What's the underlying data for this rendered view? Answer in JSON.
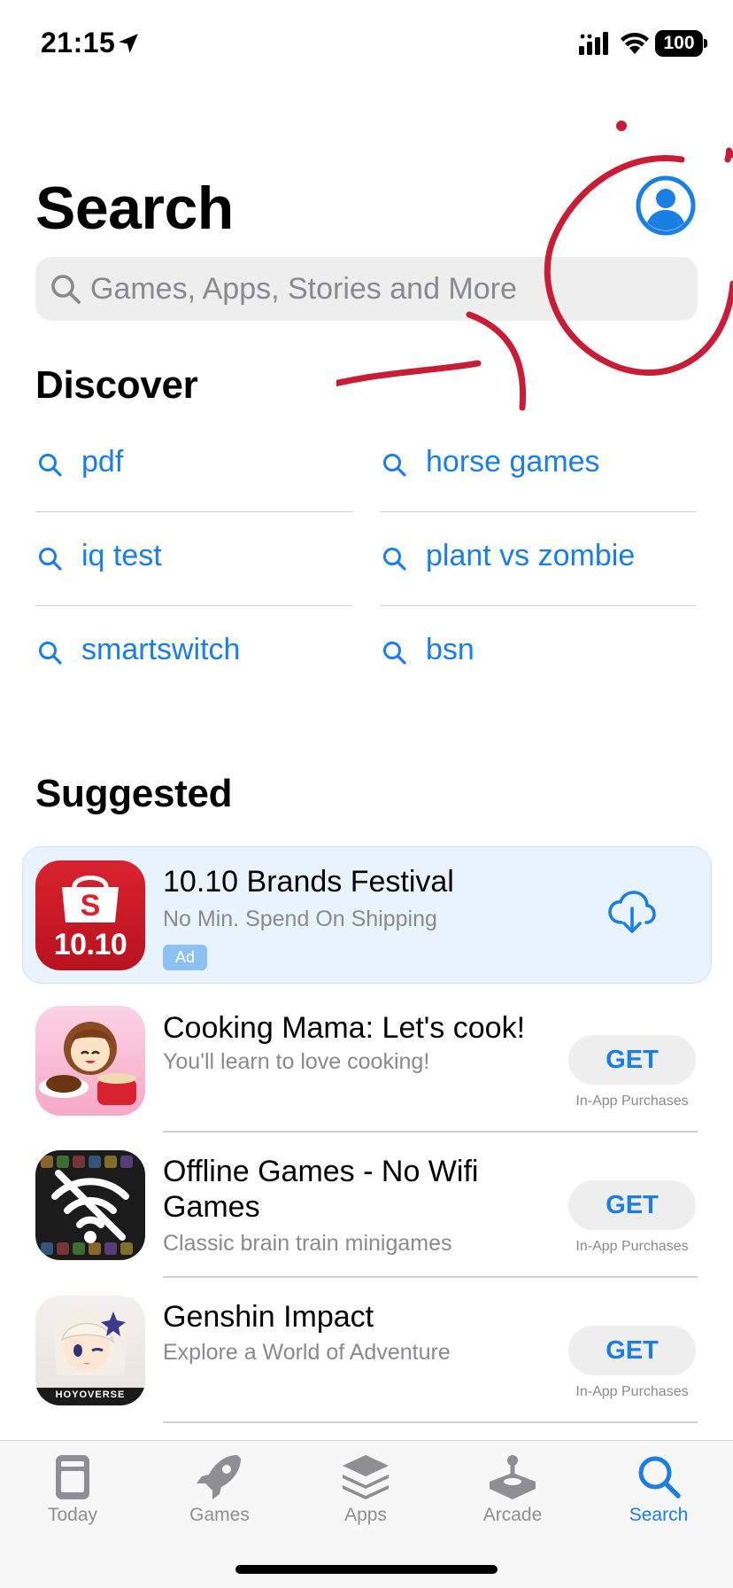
{
  "status_bar": {
    "time": "21:15",
    "battery": "100",
    "icons": [
      "location-arrow-icon",
      "cellular-signal-icon",
      "wifi-icon",
      "battery-icon"
    ]
  },
  "header": {
    "title": "Search",
    "account_icon": "person-circle-icon"
  },
  "search": {
    "placeholder": "Games, Apps, Stories and More",
    "value": "",
    "icon": "magnifying-glass-icon"
  },
  "discover": {
    "title": "Discover",
    "items": [
      {
        "label": "pdf"
      },
      {
        "label": "horse games"
      },
      {
        "label": "iq test"
      },
      {
        "label": "plant vs zombie"
      },
      {
        "label": "smartswitch"
      },
      {
        "label": "bsn"
      }
    ]
  },
  "suggested": {
    "title": "Suggested",
    "ad": {
      "name": "10.10 Brands Festival",
      "subtitle": "No Min. Spend On Shipping",
      "badge": "Ad",
      "icon_text": "10.10",
      "icon_letter": "S",
      "action_icon": "cloud-download-icon",
      "accent": "#c8102e"
    },
    "apps": [
      {
        "name": "Cooking Mama: Let's cook!",
        "subtitle": "You'll learn to love cooking!",
        "button": "GET",
        "note": "In-App Purchases"
      },
      {
        "name_line1": "Offline Games - No Wifi",
        "name_line2": "Games",
        "subtitle": "Classic brain train minigames",
        "button": "GET",
        "note": "In-App Purchases"
      },
      {
        "name": "Genshin Impact",
        "subtitle": "Explore a World of Adventure",
        "button": "GET",
        "note": "In-App Purchases",
        "icon_text": "HOYOVERSE"
      }
    ]
  },
  "tab_bar": {
    "tabs": [
      {
        "label": "Today",
        "icon": "today-icon"
      },
      {
        "label": "Games",
        "icon": "rocket-icon"
      },
      {
        "label": "Apps",
        "icon": "layers-icon"
      },
      {
        "label": "Arcade",
        "icon": "joystick-icon"
      },
      {
        "label": "Search",
        "icon": "search-icon",
        "active": true
      }
    ]
  },
  "colors": {
    "accent": "#1b7ee5",
    "scribble": "#c81e35",
    "ad_background": "#e9f3fd"
  }
}
